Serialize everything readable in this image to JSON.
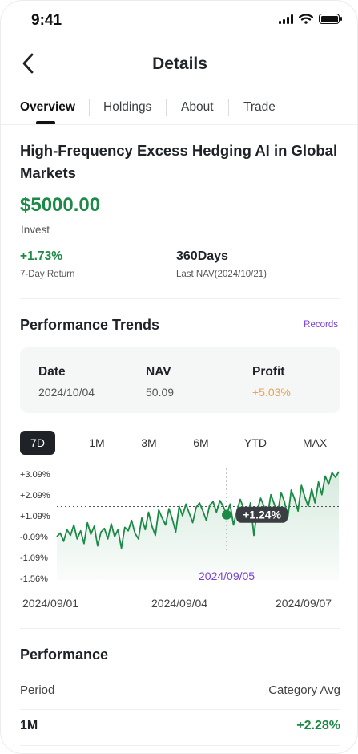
{
  "status_bar": {
    "time": "9:41"
  },
  "header": {
    "title": "Details"
  },
  "tabs": [
    {
      "label": "Overview"
    },
    {
      "label": "Holdings"
    },
    {
      "label": "About"
    },
    {
      "label": "Trade"
    }
  ],
  "fund": {
    "name": "High-Frequency Excess Hedging AI in Global Markets",
    "amount": "$5000.00",
    "amount_label": "Invest",
    "seven_day_return": "+1.73%",
    "seven_day_return_label": "7-Day Return",
    "holding_period": "360Days",
    "last_nav_label": "Last NAV(2024/10/21)"
  },
  "performance_trends": {
    "title": "Performance Trends",
    "records_link": "Records",
    "card": {
      "date_label": "Date",
      "date_value": "2024/10/04",
      "nav_label": "NAV",
      "nav_value": "50.09",
      "profit_label": "Profit",
      "profit_value": "+5.03%"
    },
    "ranges": [
      "7D",
      "1M",
      "3M",
      "6M",
      "YTD",
      "MAX"
    ],
    "active_range": "7D"
  },
  "chart_data": {
    "type": "area",
    "y_tick_labels": [
      "+3.09%",
      "+2.09%",
      "+1.09%",
      "-0.09%",
      "-1.09%",
      "-1.56%"
    ],
    "x_tick_labels": [
      "2024/09/01",
      "2024/09/04",
      "2024/09/07"
    ],
    "tooltip_value": "+1.24%",
    "tooltip_date": "2024/09/05",
    "reference_value": 1.59,
    "ylim": [
      -1.56,
      3.09
    ],
    "line_color": "#1a8a45",
    "tooltip_color": "#7a3fd6",
    "series": [
      {
        "values": [
          0.3,
          0.45,
          0.1,
          0.6,
          0.35,
          0.8,
          0.2,
          0.55,
          0.0,
          0.9,
          0.4,
          0.75,
          -0.1,
          0.5,
          0.65,
          0.2,
          0.85,
          0.3,
          0.6,
          -0.2,
          0.7,
          0.55,
          1.0,
          0.45,
          0.2,
          1.1,
          0.6,
          1.35,
          0.75,
          0.35,
          1.45,
          1.1,
          0.8,
          1.5,
          1.05,
          0.5,
          1.6,
          1.2,
          1.7,
          1.3,
          0.9,
          1.55,
          1.75,
          1.4,
          1.0,
          1.65,
          1.8,
          1.35,
          1.85,
          1.6,
          1.24,
          1.7,
          0.8,
          1.4,
          1.9,
          1.5,
          1.05,
          1.75,
          0.35,
          1.45,
          1.95,
          1.6,
          1.2,
          2.1,
          1.7,
          1.3,
          2.2,
          1.8,
          1.15,
          2.3,
          1.9,
          1.4,
          2.5,
          2.0,
          1.6,
          2.35,
          1.75,
          2.65,
          2.1,
          2.9,
          2.55,
          3.05,
          2.85,
          3.09
        ]
      }
    ]
  },
  "performance": {
    "title": "Performance",
    "period_header": "Period",
    "category_avg_header": "Category Avg",
    "rows": [
      {
        "period": "1M",
        "avg": "+2.28%"
      }
    ]
  }
}
